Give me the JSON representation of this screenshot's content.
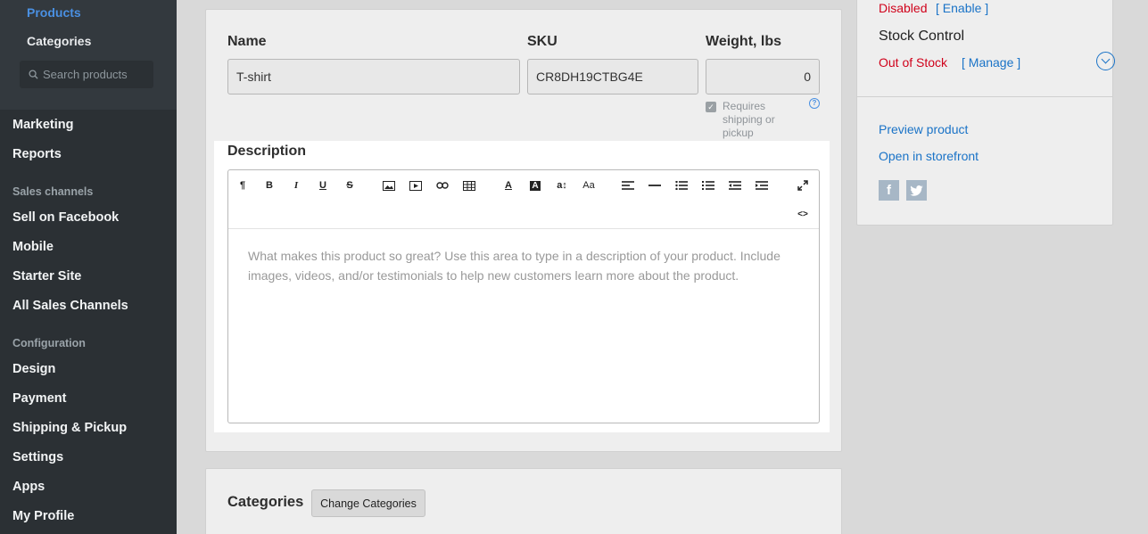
{
  "sidebar": {
    "catalog_sub": {
      "products": "Products",
      "categories": "Categories",
      "search_placeholder": "Search products"
    },
    "items": {
      "marketing": "Marketing",
      "reports": "Reports",
      "sales_channels_heading": "Sales channels",
      "sell_on_facebook": "Sell on Facebook",
      "mobile": "Mobile",
      "starter_site": "Starter Site",
      "all_sales_channels": "All Sales Channels",
      "configuration_heading": "Configuration",
      "design": "Design",
      "payment": "Payment",
      "shipping_pickup": "Shipping & Pickup",
      "settings": "Settings",
      "apps": "Apps",
      "my_profile": "My Profile"
    }
  },
  "product": {
    "name_label": "Name",
    "name_value": "T-shirt",
    "sku_label": "SKU",
    "sku_value": "CR8DH19CTBG4E",
    "weight_label": "Weight, lbs",
    "weight_value": "0",
    "requires_shipping_label": "Requires shipping or pickup",
    "requires_shipping_checked": true
  },
  "description": {
    "label": "Description",
    "placeholder": "What makes this product so great? Use this area to type in a description of your product. Include images, videos, and/or testimonials to help new customers learn more about the product."
  },
  "toolbar": {
    "buttons": [
      "paragraph-icon",
      "bold-icon",
      "italic-icon",
      "underline-icon",
      "strikethrough-icon",
      "image-icon",
      "video-icon",
      "link-icon",
      "table-icon",
      "font-color-icon",
      "highlight-icon",
      "font-size-icon",
      "font-family-icon",
      "align-icon",
      "horizontal-line-icon",
      "unordered-list-icon",
      "ordered-list-icon",
      "outdent-icon",
      "indent-icon",
      "fullscreen-icon",
      "code-view-icon"
    ]
  },
  "right_panel": {
    "status_text": "Disabled",
    "enable_link": "[ Enable ]",
    "stock_control_label": "Stock Control",
    "stock_status": "Out of Stock",
    "manage_link": "[ Manage ]",
    "preview_link": "Preview product",
    "storefront_link": "Open in storefront"
  },
  "categories": {
    "label": "Categories",
    "change_button": "Change Categories"
  },
  "colors": {
    "accent": "#1a73c7",
    "danger": "#d0021b",
    "sidebar_bg": "#2b3034"
  }
}
